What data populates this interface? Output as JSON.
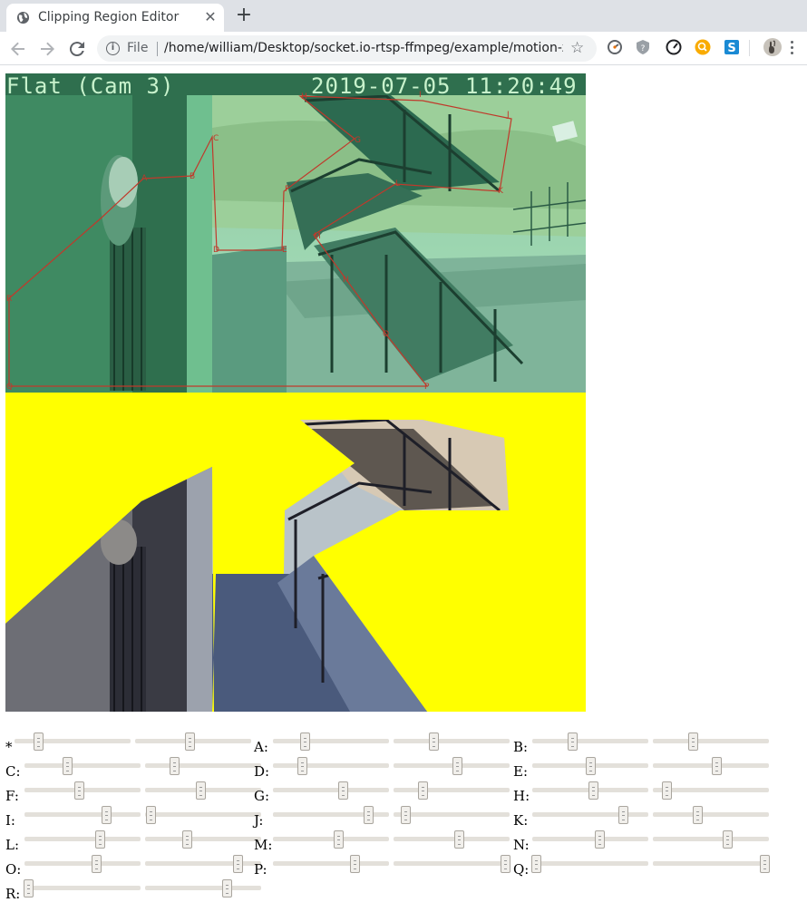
{
  "browser": {
    "tab_title": "Clipping Region Editor",
    "tab_close_glyph": "✕",
    "new_tab_glyph": "+",
    "scheme_label": "File",
    "url": "/home/william/Desktop/socket.io-rtsp-ffmpeg/example/motion-zo...",
    "icons": [
      "globe-icon",
      "back-icon",
      "forward-icon",
      "reload-icon",
      "info-icon",
      "star-icon",
      "speedometer-icon",
      "shield-icon",
      "gauge-icon",
      "search-extension-icon",
      "s-extension-icon",
      "profile-avatar-icon"
    ]
  },
  "camera": {
    "caption": "Flat (Cam 3)",
    "timestamp": "2019-07-05 11:20:49",
    "points": [
      "A",
      "B",
      "C",
      "D",
      "E",
      "F",
      "G",
      "H",
      "I",
      "J",
      "K",
      "L",
      "M",
      "N",
      "O",
      "P",
      "Q",
      "R"
    ]
  },
  "colors": {
    "highlight": "#ffff00",
    "region_outline": "#c0392b",
    "tint": "#5fd98e"
  },
  "controls": [
    {
      "label": "*",
      "values": [
        0.2,
        0.47
      ]
    },
    {
      "label": "A:",
      "values": [
        0.27,
        0.34
      ]
    },
    {
      "label": "B:",
      "values": [
        0.34,
        0.34
      ]
    },
    {
      "label": "C:",
      "values": [
        0.37,
        0.25
      ]
    },
    {
      "label": "D:",
      "values": [
        0.25,
        0.55
      ]
    },
    {
      "label": "E:",
      "values": [
        0.5,
        0.55
      ]
    },
    {
      "label": "F:",
      "values": [
        0.47,
        0.48
      ]
    },
    {
      "label": "G:",
      "values": [
        0.6,
        0.25
      ]
    },
    {
      "label": "H:",
      "values": [
        0.52,
        0.12
      ]
    },
    {
      "label": "I:",
      "values": [
        0.7,
        0.05
      ]
    },
    {
      "label": "J:",
      "values": [
        0.82,
        0.1
      ]
    },
    {
      "label": "K:",
      "values": [
        0.78,
        0.38
      ]
    },
    {
      "label": "L:",
      "values": [
        0.65,
        0.36
      ]
    },
    {
      "label": "M:",
      "values": [
        0.56,
        0.56
      ]
    },
    {
      "label": "N:",
      "values": [
        0.58,
        0.64
      ]
    },
    {
      "label": "O:",
      "values": [
        0.62,
        0.8
      ]
    },
    {
      "label": "P:",
      "values": [
        0.7,
        0.96
      ]
    },
    {
      "label": "Q:",
      "values": [
        0.03,
        0.96
      ]
    },
    {
      "label": "R:",
      "values": [
        0.03,
        0.7
      ]
    }
  ]
}
